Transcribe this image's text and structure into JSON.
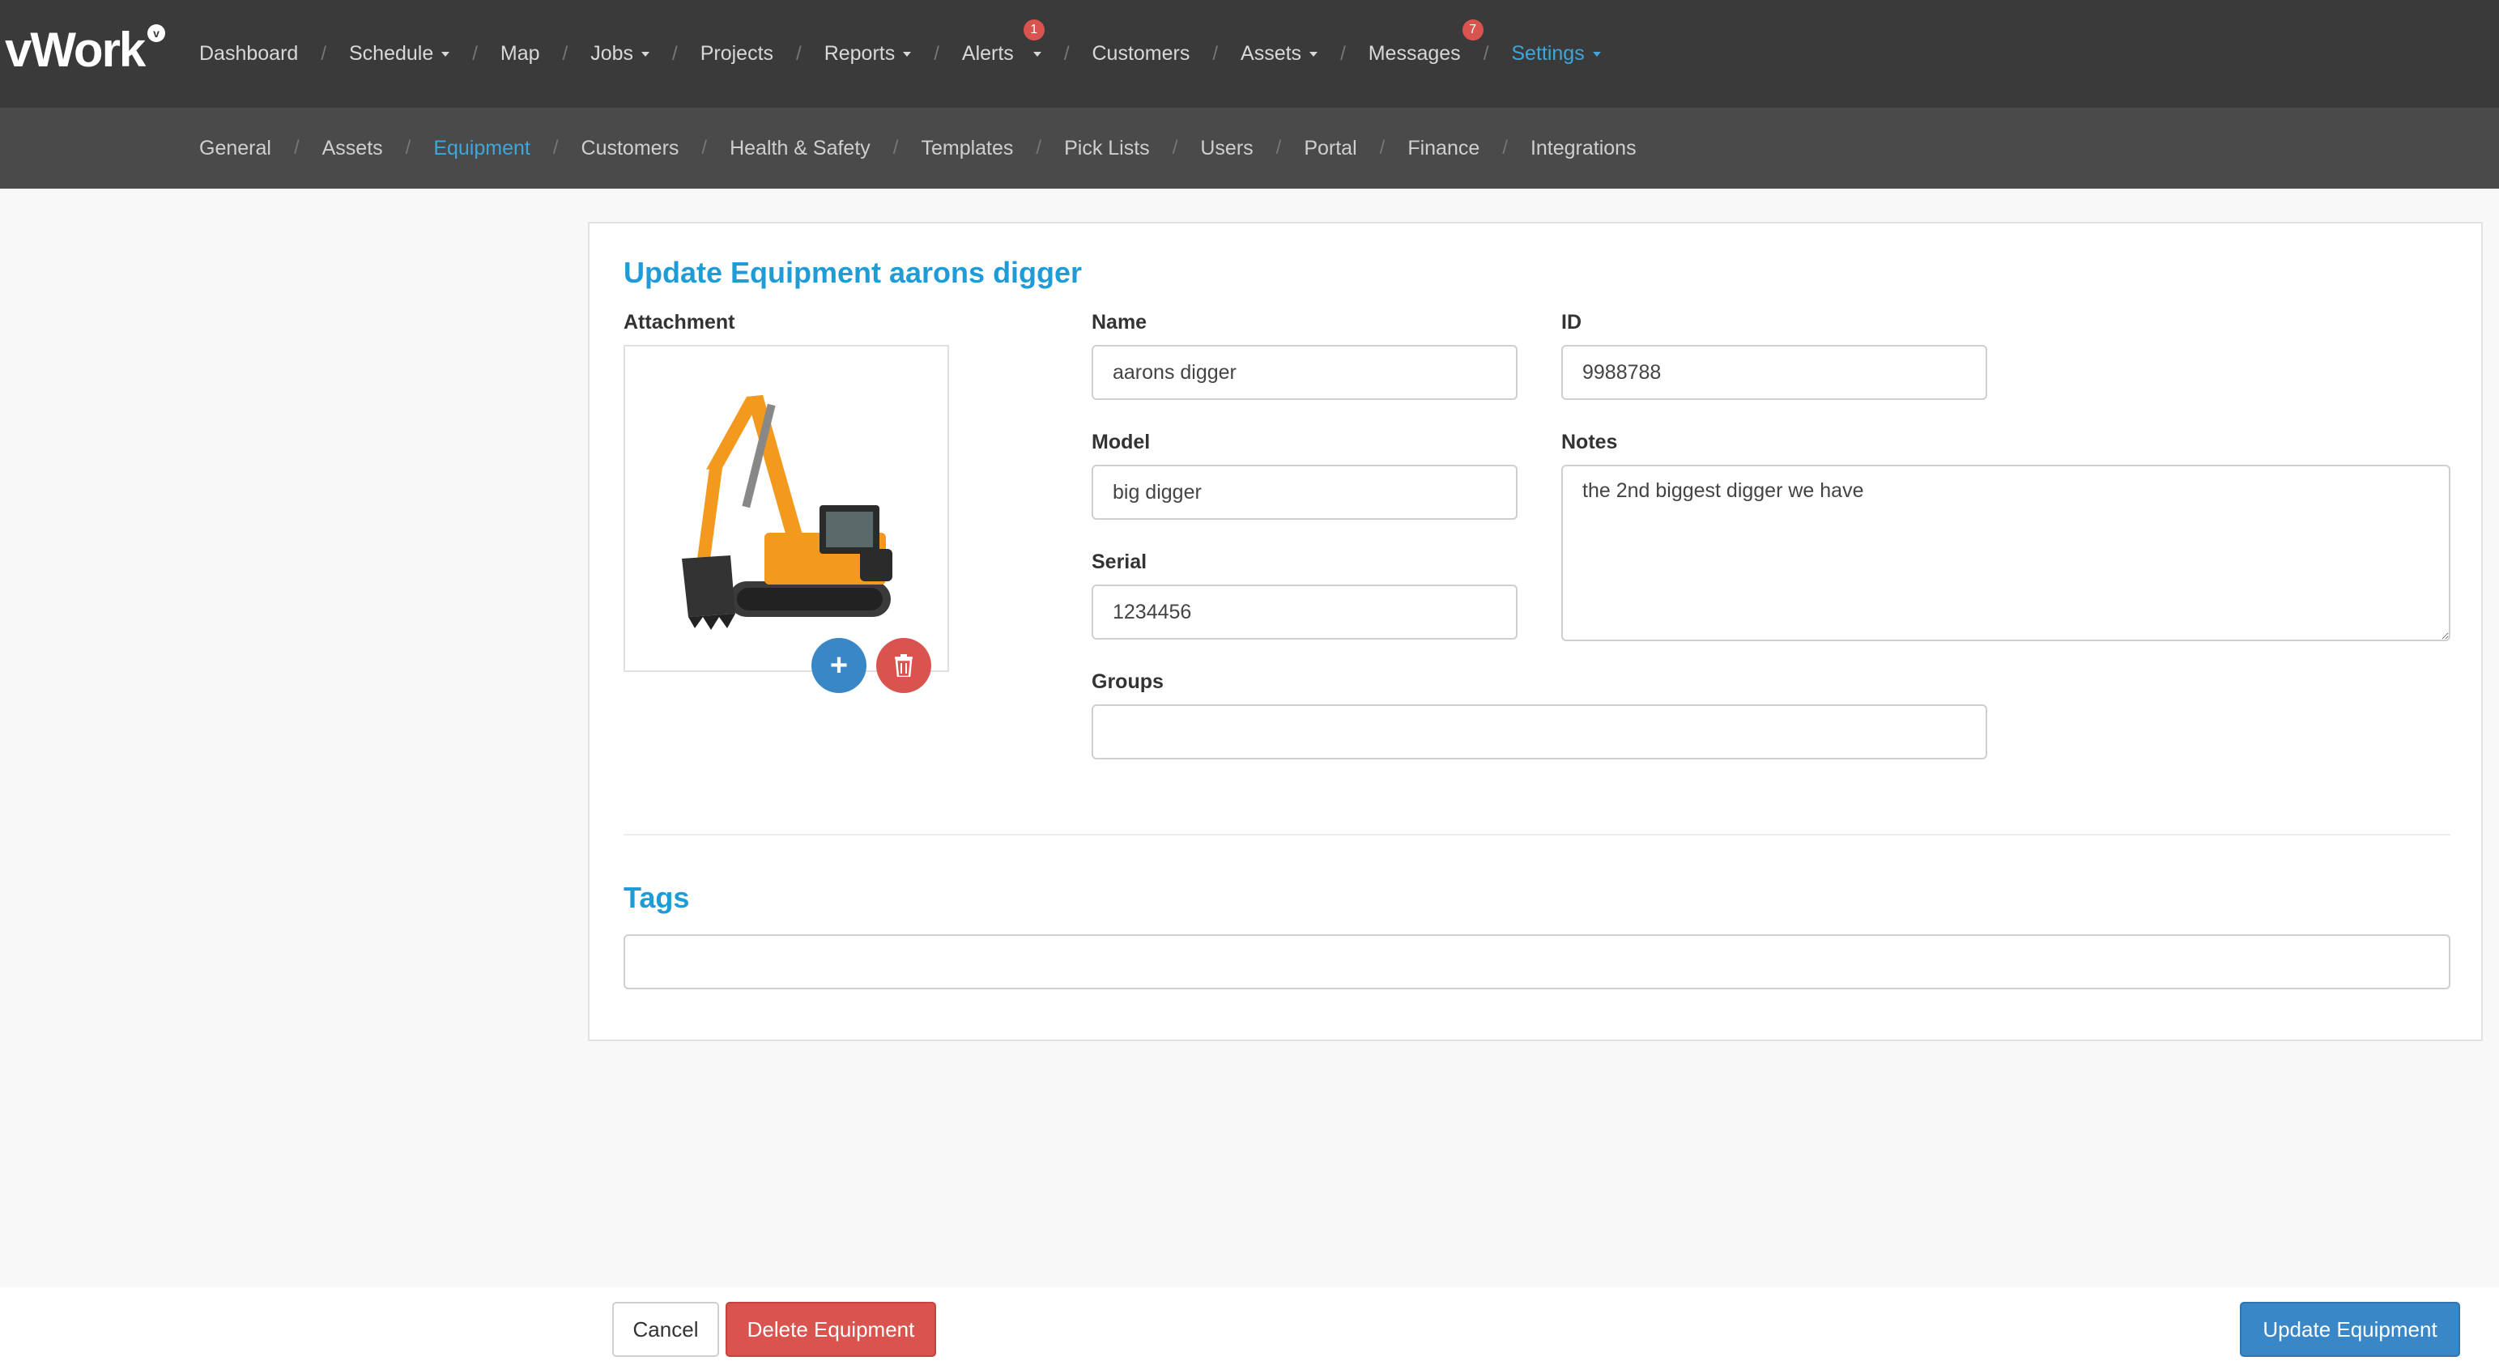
{
  "app": {
    "logo": "vWork",
    "logo_badge": "v"
  },
  "topnav": {
    "items": [
      {
        "label": "Dashboard"
      },
      {
        "label": "Schedule"
      },
      {
        "label": "Map"
      },
      {
        "label": "Jobs"
      },
      {
        "label": "Projects"
      },
      {
        "label": "Reports"
      },
      {
        "label": "Alerts",
        "badge": "1"
      },
      {
        "label": "Customers"
      },
      {
        "label": "Assets"
      },
      {
        "label": "Messages",
        "badge": "7"
      },
      {
        "label": "Settings"
      }
    ]
  },
  "subnav": {
    "items": [
      {
        "label": "General"
      },
      {
        "label": "Assets"
      },
      {
        "label": "Equipment"
      },
      {
        "label": "Customers"
      },
      {
        "label": "Health & Safety"
      },
      {
        "label": "Templates"
      },
      {
        "label": "Pick Lists"
      },
      {
        "label": "Users"
      },
      {
        "label": "Portal"
      },
      {
        "label": "Finance"
      },
      {
        "label": "Integrations"
      }
    ]
  },
  "form": {
    "title": "Update Equipment aarons digger",
    "attachment_label": "Attachment",
    "attachment_icon": "excavator-image",
    "name_label": "Name",
    "name_value": "aarons digger",
    "id_label": "ID",
    "id_value": "9988788",
    "model_label": "Model",
    "model_value": "big digger",
    "notes_label": "Notes",
    "notes_value": "the 2nd biggest digger we have",
    "serial_label": "Serial",
    "serial_value": "1234456",
    "groups_label": "Groups",
    "groups_value": "",
    "tags_title": "Tags",
    "tags_value": ""
  },
  "footer": {
    "cancel_label": "Cancel",
    "delete_label": "Delete Equipment",
    "update_label": "Update Equipment"
  },
  "colors": {
    "accent": "#1f9bd6",
    "danger": "#d9534f",
    "primary": "#3a87c8",
    "nav_bg": "#3a3a3a",
    "subnav_bg": "#4a4a4a"
  }
}
